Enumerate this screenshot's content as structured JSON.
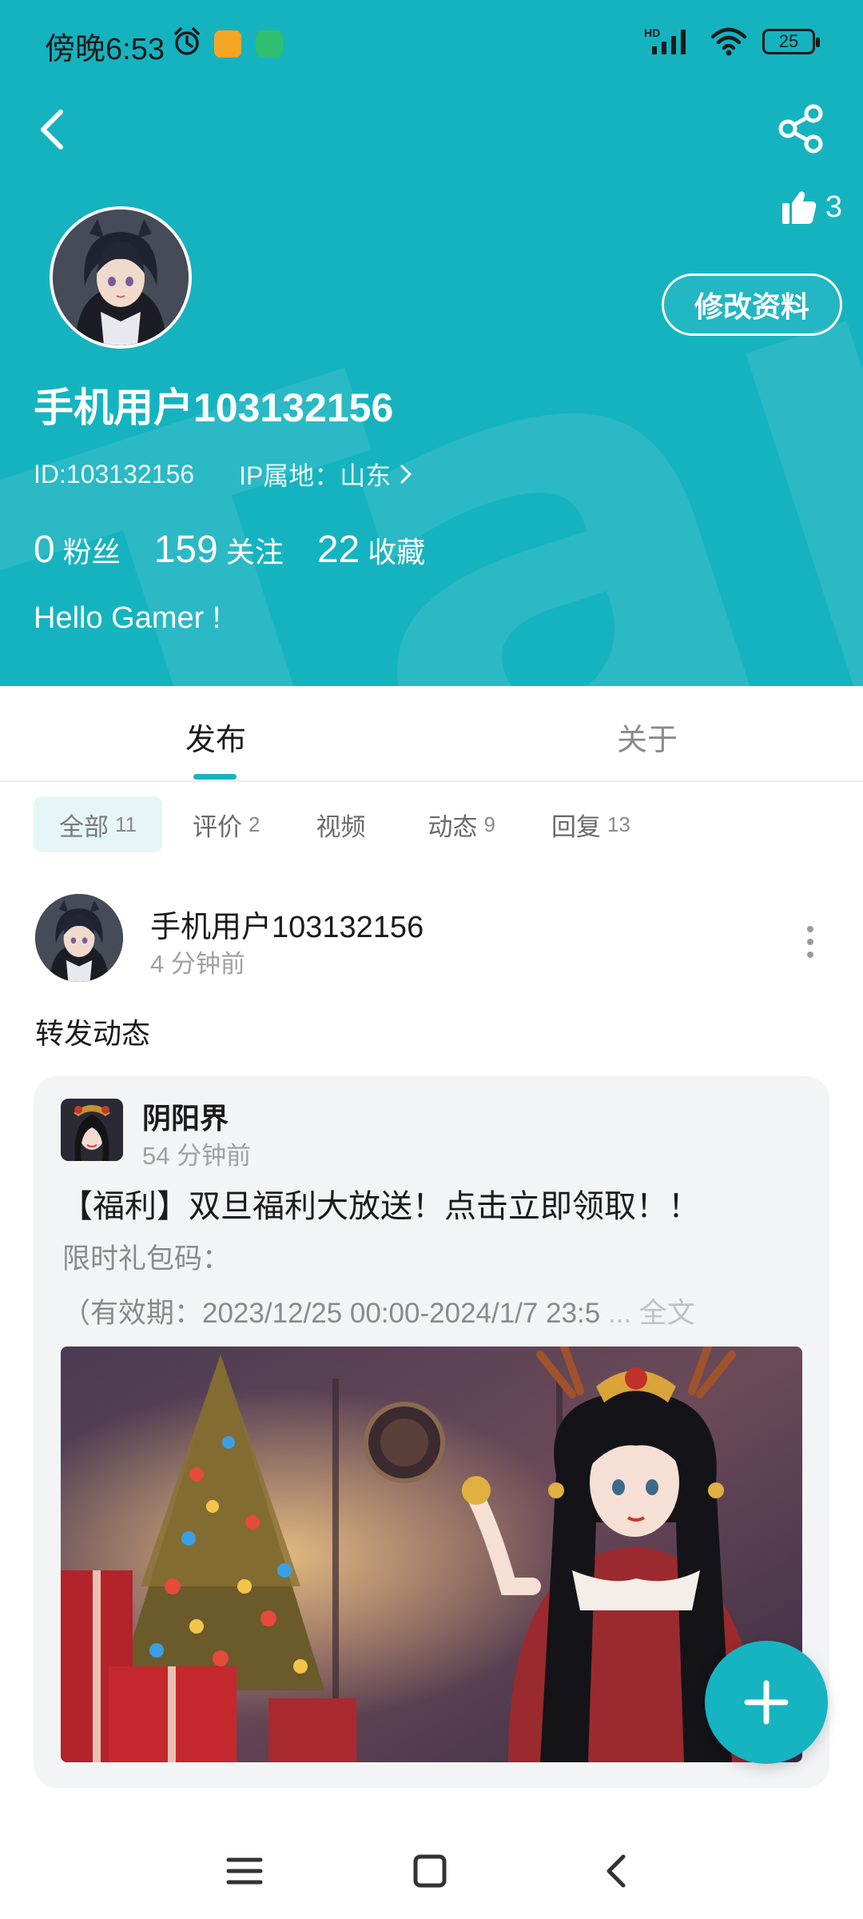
{
  "status_bar": {
    "time": "傍晚6:53",
    "battery": "25",
    "network": "HD"
  },
  "header": {
    "watermark": "TapTap",
    "likes_count": "3",
    "edit_profile_label": "修改资料",
    "username": "手机用户103132156",
    "user_id": "ID:103132156",
    "ip_location": "IP属地：山东",
    "stats": [
      {
        "value": "0",
        "label": "粉丝"
      },
      {
        "value": "159",
        "label": "关注"
      },
      {
        "value": "22",
        "label": "收藏"
      }
    ],
    "bio": "Hello Gamer !"
  },
  "tabs": [
    {
      "label": "发布"
    },
    {
      "label": "关于"
    }
  ],
  "filters": [
    {
      "label": "全部",
      "count": "11"
    },
    {
      "label": "评价",
      "count": "2"
    },
    {
      "label": "视频",
      "count": ""
    },
    {
      "label": "动态",
      "count": "9"
    },
    {
      "label": "回复",
      "count": "13"
    }
  ],
  "post": {
    "author": "手机用户103132156",
    "time": "4 分钟前",
    "text": "转发动态",
    "repost": {
      "author": "阴阳界",
      "time": "54 分钟前",
      "title": "【福利】双旦福利大放送！点击立即领取！！",
      "line2": "限时礼包码：",
      "line3": "（有效期：2023/12/25 00:00-2024/1/7 23:5",
      "more": "... 全文"
    }
  },
  "colors": {
    "accent": "#15b3c0",
    "text": "#1b1b1b",
    "muted": "#a0a0a0"
  }
}
